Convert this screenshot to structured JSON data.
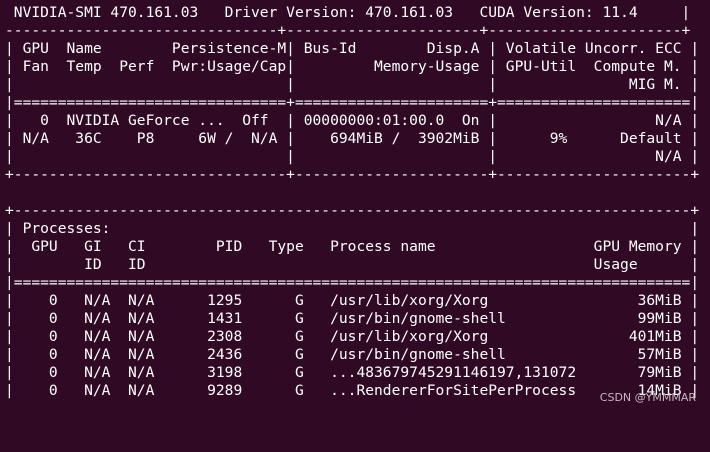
{
  "terminal": {
    "lines": [
      " NVIDIA-SMI 470.161.03   Driver Version: 470.161.03   CUDA Version: 11.4     |",
      "-------------------------------+----------------------+----------------------+",
      "| GPU  Name        Persistence-M| Bus-Id        Disp.A | Volatile Uncorr. ECC |",
      "| Fan  Temp  Perf  Pwr:Usage/Cap|         Memory-Usage | GPU-Util  Compute M. |",
      "|                               |                      |               MIG M. |",
      "|===============================+======================+======================|",
      "|   0  NVIDIA GeForce ...  Off  | 00000000:01:00.0  On |                  N/A |",
      "| N/A   36C    P8     6W /  N/A |    694MiB /  3902MiB |      9%      Default |",
      "|                               |                      |                  N/A |",
      "+-------------------------------+----------------------+----------------------+",
      "                                                                               ",
      "+-----------------------------------------------------------------------------+",
      "| Processes:                                                                  |",
      "|  GPU   GI   CI        PID   Type   Process name                  GPU Memory |",
      "|        ID   ID                                                   Usage      |",
      "|=============================================================================|",
      "|    0   N/A  N/A      1295      G   /usr/lib/xorg/Xorg                 36MiB |",
      "|    0   N/A  N/A      1431      G   /usr/bin/gnome-shell               99MiB |",
      "|    0   N/A  N/A      2308      G   /usr/lib/xorg/Xorg                401MiB |",
      "|    0   N/A  N/A      2436      G   /usr/bin/gnome-shell               57MiB |",
      "|    0   N/A  N/A      3198      G   ...483679745291146197,131072       79MiB |",
      "|    0   N/A  N/A      9289      G   ...RendererForSitePerProcess       14MiB |"
    ],
    "watermark": "CSDN @YMMMAR"
  }
}
